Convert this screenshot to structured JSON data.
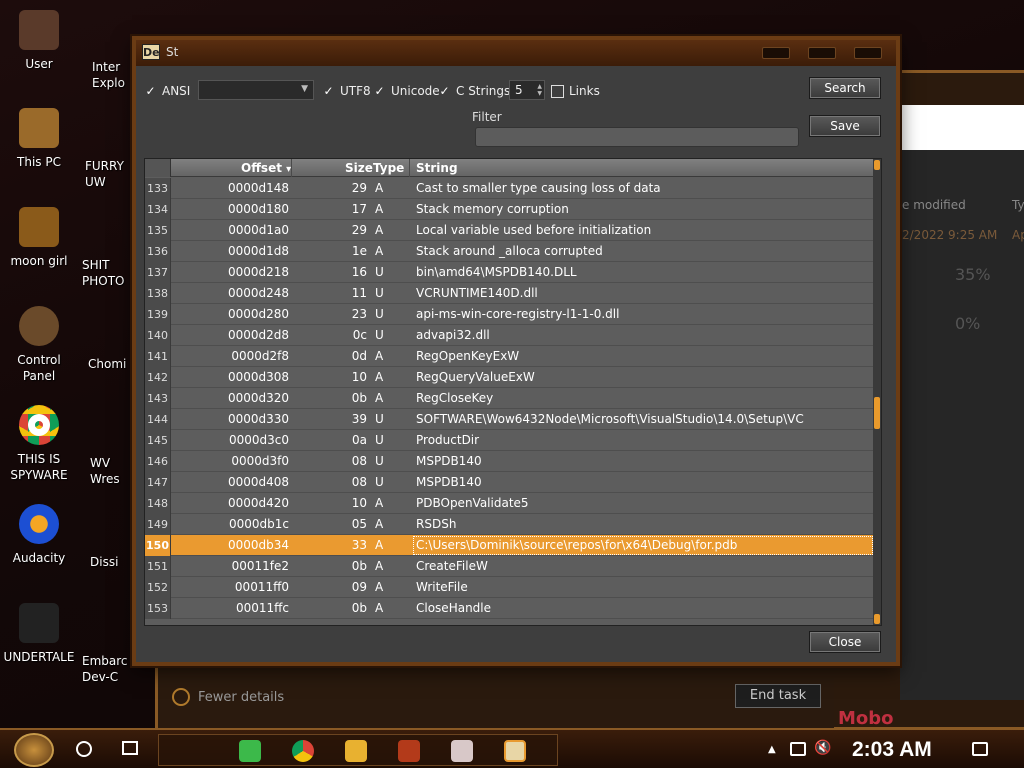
{
  "desktop": {
    "icons": [
      {
        "label": "User"
      },
      {
        "label": "This PC"
      },
      {
        "label": "moon girl"
      },
      {
        "label": "Control Panel"
      },
      {
        "label": "THIS IS SPYWARE"
      },
      {
        "label": "Audacity"
      },
      {
        "label": "UNDERTALE"
      }
    ],
    "partial": {
      "inter": "Inter\nExplo",
      "furry": "FURRY\nUW",
      "shit": "SHIT\nPHOTO",
      "chomi": "Chomi",
      "wv": "WV\nWres",
      "dissi": "Dissi",
      "embarc": "Embarc\nDev-C"
    }
  },
  "background_window": {
    "modified_header": "e modified",
    "ty_header": "Ty",
    "date_row": "2/2022 9:25 AM",
    "ap_col": "Ap",
    "percent1": "35%",
    "percent2": "0%",
    "fewer_details": "Fewer details",
    "end_task": "End task",
    "mobo_text": "Mobo"
  },
  "dialog": {
    "title": "St",
    "options": {
      "ansi_label": "ANSI",
      "ansi_checked": true,
      "encoding_value": "",
      "utf8_label": "UTF8",
      "utf8_checked": true,
      "unicode_label": "Unicode",
      "unicode_checked": true,
      "cstrings_label": "C Strings",
      "cstrings_checked": true,
      "min_length": "5",
      "links_label": "Links",
      "links_checked": false
    },
    "filter_label": "Filter",
    "filter_value": "",
    "search_button": "Search",
    "save_button": "Save",
    "close_button": "Close"
  },
  "grid": {
    "columns": {
      "offset": "Offset",
      "size": "Size",
      "type": "Type",
      "string": "String"
    },
    "sort_indicator": "▾",
    "selected_row": "150",
    "rows": [
      {
        "n": "133",
        "offset": "0000d148",
        "size": "29",
        "type": "A",
        "string": "Cast to smaller type causing loss of data"
      },
      {
        "n": "134",
        "offset": "0000d180",
        "size": "17",
        "type": "A",
        "string": "Stack memory corruption"
      },
      {
        "n": "135",
        "offset": "0000d1a0",
        "size": "29",
        "type": "A",
        "string": "Local variable used before initialization"
      },
      {
        "n": "136",
        "offset": "0000d1d8",
        "size": "1e",
        "type": "A",
        "string": "Stack around _alloca corrupted"
      },
      {
        "n": "137",
        "offset": "0000d218",
        "size": "16",
        "type": "U",
        "string": "bin\\amd64\\MSPDB140.DLL"
      },
      {
        "n": "138",
        "offset": "0000d248",
        "size": "11",
        "type": "U",
        "string": "VCRUNTIME140D.dll"
      },
      {
        "n": "139",
        "offset": "0000d280",
        "size": "23",
        "type": "U",
        "string": "api-ms-win-core-registry-l1-1-0.dll"
      },
      {
        "n": "140",
        "offset": "0000d2d8",
        "size": "0c",
        "type": "U",
        "string": "advapi32.dll"
      },
      {
        "n": "141",
        "offset": "0000d2f8",
        "size": "0d",
        "type": "A",
        "string": "RegOpenKeyExW"
      },
      {
        "n": "142",
        "offset": "0000d308",
        "size": "10",
        "type": "A",
        "string": "RegQueryValueExW"
      },
      {
        "n": "143",
        "offset": "0000d320",
        "size": "0b",
        "type": "A",
        "string": "RegCloseKey"
      },
      {
        "n": "144",
        "offset": "0000d330",
        "size": "39",
        "type": "U",
        "string": "SOFTWARE\\Wow6432Node\\Microsoft\\VisualStudio\\14.0\\Setup\\VC"
      },
      {
        "n": "145",
        "offset": "0000d3c0",
        "size": "0a",
        "type": "U",
        "string": "ProductDir"
      },
      {
        "n": "146",
        "offset": "0000d3f0",
        "size": "08",
        "type": "U",
        "string": "MSPDB140"
      },
      {
        "n": "147",
        "offset": "0000d408",
        "size": "08",
        "type": "U",
        "string": "MSPDB140"
      },
      {
        "n": "148",
        "offset": "0000d420",
        "size": "10",
        "type": "A",
        "string": "PDBOpenValidate5"
      },
      {
        "n": "149",
        "offset": "0000db1c",
        "size": "05",
        "type": "A",
        "string": "RSDSh"
      },
      {
        "n": "150",
        "offset": "0000db34",
        "size": "33",
        "type": "A",
        "string": "C:\\Users\\Dominik\\source\\repos\\for\\x64\\Debug\\for.pdb"
      },
      {
        "n": "151",
        "offset": "00011fe2",
        "size": "0b",
        "type": "A",
        "string": "CreateFileW"
      },
      {
        "n": "152",
        "offset": "00011ff0",
        "size": "09",
        "type": "A",
        "string": "WriteFile"
      },
      {
        "n": "153",
        "offset": "00011ffc",
        "size": "0b",
        "type": "A",
        "string": "CloseHandle"
      }
    ]
  },
  "taskbar": {
    "time": "2:03 AM"
  },
  "colors": {
    "accent": "#ea9a30",
    "dialog_bg": "#3e3e3e",
    "grid_bg": "#5d5d5d",
    "frame": "#6b3c14"
  }
}
